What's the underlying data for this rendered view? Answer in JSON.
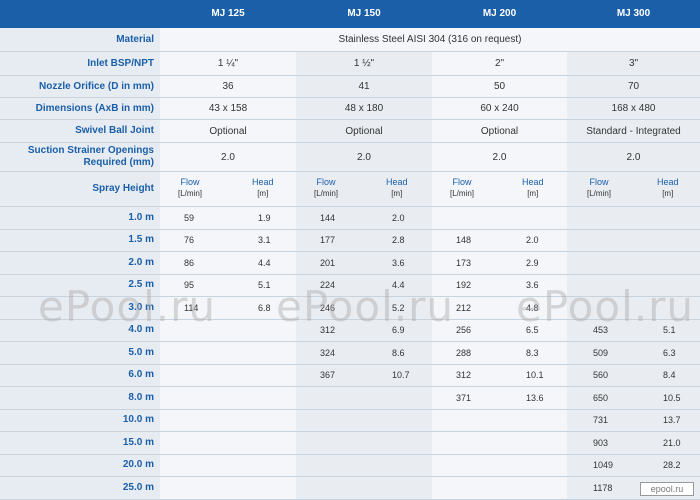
{
  "header": {
    "models": [
      "MJ 125",
      "MJ 150",
      "MJ 200",
      "MJ 300"
    ]
  },
  "specs": {
    "material_label": "Material",
    "material_value": "Stainless Steel AISI 304 (316 on request)",
    "inlet_label": "Inlet BSP/NPT",
    "inlet_values": [
      "1 ¼\"",
      "1 ½\"",
      "2\"",
      "3\""
    ],
    "nozzle_label": "Nozzle Orifice (D in mm)",
    "nozzle_values": [
      "36",
      "41",
      "50",
      "70"
    ],
    "dimensions_label": "Dimensions (AxB in mm)",
    "dimensions_values": [
      "43 x 158",
      "48 x 180",
      "60 x 240",
      "168 x 480"
    ],
    "swivel_label": "Swivel Ball Joint",
    "swivel_values": [
      "Optional",
      "Optional",
      "Optional",
      "Standard - Integrated"
    ],
    "strainer_label_1": "Suction Strainer Openings",
    "strainer_label_2": "Required (mm)",
    "strainer_values": [
      "2.0",
      "2.0",
      "2.0",
      "2.0"
    ]
  },
  "spray": {
    "label": "Spray Height",
    "flow_label": "Flow",
    "flow_unit": "[L/min]",
    "head_label": "Head",
    "head_unit": "[m]",
    "rows": [
      {
        "h": "1.0 m",
        "v": [
          "59",
          "1.9",
          "144",
          "2.0",
          "",
          "",
          "",
          ""
        ]
      },
      {
        "h": "1.5 m",
        "v": [
          "76",
          "3.1",
          "177",
          "2.8",
          "148",
          "2.0",
          "",
          ""
        ]
      },
      {
        "h": "2.0 m",
        "v": [
          "86",
          "4.4",
          "201",
          "3.6",
          "173",
          "2.9",
          "",
          ""
        ]
      },
      {
        "h": "2.5 m",
        "v": [
          "95",
          "5.1",
          "224",
          "4.4",
          "192",
          "3.6",
          "",
          ""
        ]
      },
      {
        "h": "3.0 m",
        "v": [
          "114",
          "6.8",
          "246",
          "5.2",
          "212",
          "4.8",
          "",
          ""
        ]
      },
      {
        "h": "4.0 m",
        "v": [
          "",
          "",
          "312",
          "6.9",
          "256",
          "6.5",
          "453",
          "5.1"
        ]
      },
      {
        "h": "5.0 m",
        "v": [
          "",
          "",
          "324",
          "8.6",
          "288",
          "8.3",
          "509",
          "6.3"
        ]
      },
      {
        "h": "6.0 m",
        "v": [
          "",
          "",
          "367",
          "10.7",
          "312",
          "10.1",
          "560",
          "8.4"
        ]
      },
      {
        "h": "8.0 m",
        "v": [
          "",
          "",
          "",
          "",
          "371",
          "13.6",
          "650",
          "10.5"
        ]
      },
      {
        "h": "10.0 m",
        "v": [
          "",
          "",
          "",
          "",
          "",
          "",
          "731",
          "13.7"
        ]
      },
      {
        "h": "15.0 m",
        "v": [
          "",
          "",
          "",
          "",
          "",
          "",
          "903",
          "21.0"
        ]
      },
      {
        "h": "20.0 m",
        "v": [
          "",
          "",
          "",
          "",
          "",
          "",
          "1049",
          "28.2"
        ]
      },
      {
        "h": "25.0 m",
        "v": [
          "",
          "",
          "",
          "",
          "",
          "",
          "1178",
          ""
        ]
      }
    ]
  },
  "watermark": "ePool.ru",
  "logo_text": "epool.ru"
}
